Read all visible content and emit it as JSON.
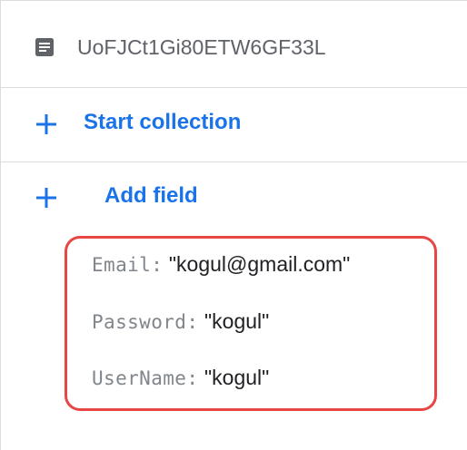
{
  "document": {
    "id": "UoFJCt1Gi80ETW6GF33L",
    "icon": "document-icon"
  },
  "actions": {
    "start_collection": {
      "label": "Start collection",
      "icon": "plus-icon"
    },
    "add_field": {
      "label": "Add field",
      "icon": "plus-icon"
    }
  },
  "fields": [
    {
      "key": "Email",
      "separator": ":",
      "value": "\"kogul@gmail.com\""
    },
    {
      "key": "Password",
      "separator": ":",
      "value": "\"kogul\""
    },
    {
      "key": "UserName",
      "separator": ":",
      "value": "\"kogul\""
    }
  ],
  "colors": {
    "accent": "#1a73e8",
    "highlight_border": "#e84545",
    "divider": "#dadce0"
  }
}
